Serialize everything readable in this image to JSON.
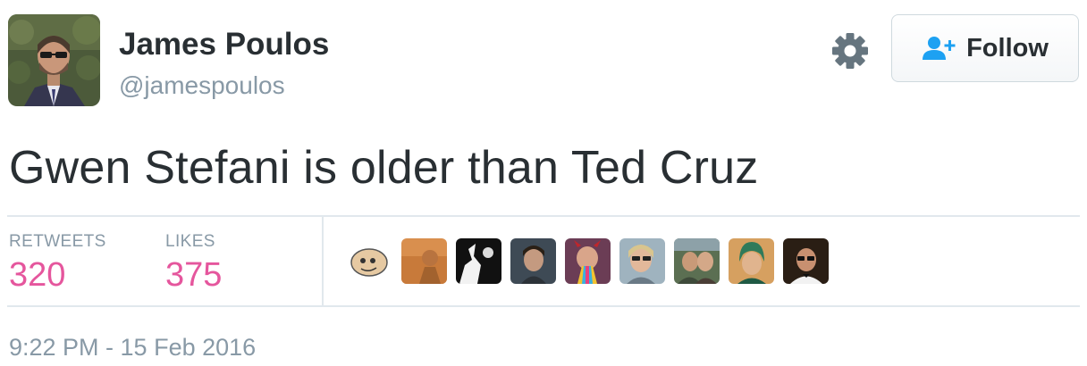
{
  "author": {
    "display_name": "James Poulos",
    "screen_name": "@jamespoulos"
  },
  "actions": {
    "settings_icon": "gear-icon",
    "follow_icon": "person-add-icon",
    "follow_label": "Follow"
  },
  "tweet": {
    "text": "Gwen Stefani is older than Ted Cruz",
    "timestamp": "9:22 PM - 15 Feb 2016"
  },
  "stats": {
    "retweets_label": "RETWEETS",
    "retweets_count": "320",
    "likes_label": "LIKES",
    "likes_count": "375"
  },
  "colors": {
    "stat_value": "#e5569d",
    "muted_text": "#8899a6",
    "follow_icon": "#1da1f2"
  }
}
